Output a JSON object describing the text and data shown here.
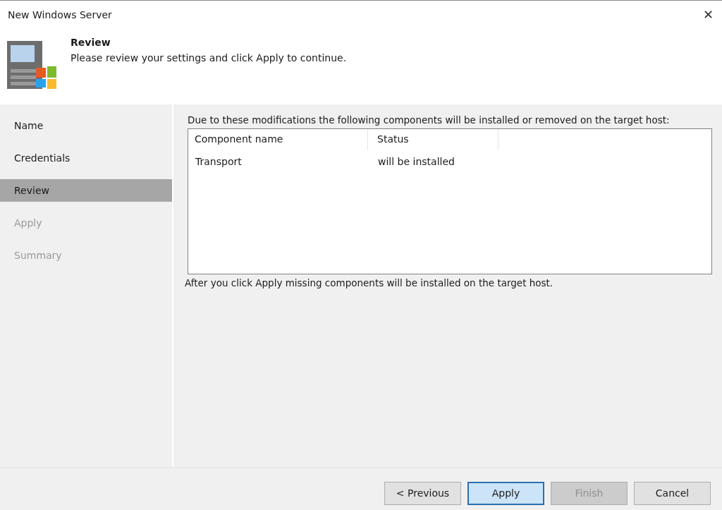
{
  "window": {
    "title": "New Windows Server",
    "close": "✕"
  },
  "header": {
    "title": "Review",
    "subtitle": "Please review your settings and click Apply to continue."
  },
  "steps": [
    {
      "label": "Name",
      "selected": false,
      "disabled": false
    },
    {
      "label": "Credentials",
      "selected": false,
      "disabled": false
    },
    {
      "label": "Review",
      "selected": true,
      "disabled": false
    },
    {
      "label": "Apply",
      "selected": false,
      "disabled": true
    },
    {
      "label": "Summary",
      "selected": false,
      "disabled": true
    }
  ],
  "intro": "Due to these modifications the following components will be installed or removed on the target host:",
  "table": {
    "columns": [
      "Component name",
      "Status"
    ],
    "rows": [
      [
        "Transport",
        "will be installed"
      ]
    ]
  },
  "note": "After you click Apply missing components will be installed on the target host.",
  "buttons": [
    {
      "label": "< Previous",
      "disabled": false,
      "default": false
    },
    {
      "label": "Apply",
      "disabled": false,
      "default": true
    },
    {
      "label": "Finish",
      "disabled": true,
      "default": false
    },
    {
      "label": "Cancel",
      "disabled": false,
      "default": false
    }
  ]
}
